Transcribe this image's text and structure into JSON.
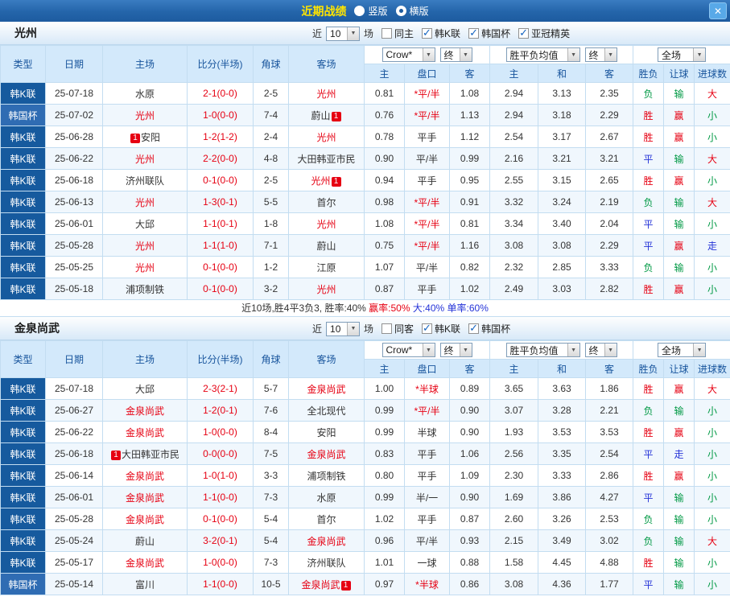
{
  "icons": {
    "dropdown": "▼",
    "close": "✕",
    "check": "✓"
  },
  "colors": {
    "win": "#e60012",
    "draw": "#2433d8",
    "lose": "#009944",
    "team_highlight": "#e60012",
    "score": "#e60012",
    "handicap_star": "#e60012",
    "header_text": "#17549c"
  },
  "league_colors": {
    "韩K联": "#165a9e",
    "韩国杯": "#2f6cb3"
  },
  "titlebar": {
    "title": "近期战绩",
    "vertical_label": "竖版",
    "horizontal_label": "横版",
    "selected_layout": "横版"
  },
  "filter_labels": {
    "near": "近",
    "count": "10",
    "matches": "场",
    "odds_source": "Crow*",
    "final1": "终",
    "avg": "胜平负均值",
    "final2": "终",
    "scope": "全场"
  },
  "table_columns": {
    "type": "类型",
    "date": "日期",
    "home": "主场",
    "score": "比分(半场)",
    "corner": "角球",
    "away": "客场",
    "odds_home": "主",
    "handicap": "盘口",
    "odds_away": "客",
    "avg_home": "主",
    "avg_draw": "和",
    "avg_away": "客",
    "result": "胜负",
    "handicap_result": "让球",
    "goal_line": "进球数"
  },
  "sections": [
    {
      "team": "光州",
      "same_filter": {
        "label": "同主",
        "checked": false
      },
      "league_filters": [
        {
          "label": "韩K联",
          "checked": true
        },
        {
          "label": "韩国杯",
          "checked": true
        },
        {
          "label": "亚冠精英",
          "checked": true
        }
      ],
      "rows": [
        {
          "league": "韩K联",
          "date": "25-07-18",
          "home": {
            "name": "水原"
          },
          "score": "2-1(0-0)",
          "corner": "2-5",
          "away": {
            "name": "光州",
            "highlight": true
          },
          "odds": [
            "0.81",
            "*平/半",
            "1.08"
          ],
          "avg": [
            "2.94",
            "3.13",
            "2.35"
          ],
          "result": "负",
          "handicap_result": "输",
          "goal_result": "大"
        },
        {
          "league": "韩国杯",
          "date": "25-07-02",
          "home": {
            "name": "光州",
            "highlight": true
          },
          "score": "1-0(0-0)",
          "corner": "7-4",
          "away": {
            "name": "蔚山",
            "badge": "1",
            "badge_pos": "after"
          },
          "odds": [
            "0.76",
            "*平/半",
            "1.13"
          ],
          "avg": [
            "2.94",
            "3.18",
            "2.29"
          ],
          "result": "胜",
          "handicap_result": "赢",
          "goal_result": "小"
        },
        {
          "league": "韩K联",
          "date": "25-06-28",
          "home": {
            "name": "安阳",
            "badge": "1",
            "badge_pos": "before"
          },
          "score": "1-2(1-2)",
          "corner": "2-4",
          "away": {
            "name": "光州",
            "highlight": true
          },
          "odds": [
            "0.78",
            "平手",
            "1.12"
          ],
          "avg": [
            "2.54",
            "3.17",
            "2.67"
          ],
          "result": "胜",
          "handicap_result": "赢",
          "goal_result": "小"
        },
        {
          "league": "韩K联",
          "date": "25-06-22",
          "home": {
            "name": "光州",
            "highlight": true
          },
          "score": "2-2(0-0)",
          "corner": "4-8",
          "away": {
            "name": "大田韩亚市民"
          },
          "odds": [
            "0.90",
            "平/半",
            "0.99"
          ],
          "avg": [
            "2.16",
            "3.21",
            "3.21"
          ],
          "result": "平",
          "handicap_result": "输",
          "goal_result": "大"
        },
        {
          "league": "韩K联",
          "date": "25-06-18",
          "home": {
            "name": "济州联队"
          },
          "score": "0-1(0-0)",
          "corner": "2-5",
          "away": {
            "name": "光州",
            "highlight": true,
            "badge": "1",
            "badge_pos": "after"
          },
          "odds": [
            "0.94",
            "平手",
            "0.95"
          ],
          "avg": [
            "2.55",
            "3.15",
            "2.65"
          ],
          "result": "胜",
          "handicap_result": "赢",
          "goal_result": "小"
        },
        {
          "league": "韩K联",
          "date": "25-06-13",
          "home": {
            "name": "光州",
            "highlight": true
          },
          "score": "1-3(0-1)",
          "corner": "5-5",
          "away": {
            "name": "首尔"
          },
          "odds": [
            "0.98",
            "*平/半",
            "0.91"
          ],
          "avg": [
            "3.32",
            "3.24",
            "2.19"
          ],
          "result": "负",
          "handicap_result": "输",
          "goal_result": "大"
        },
        {
          "league": "韩K联",
          "date": "25-06-01",
          "home": {
            "name": "大邱"
          },
          "score": "1-1(0-1)",
          "corner": "1-8",
          "away": {
            "name": "光州",
            "highlight": true
          },
          "odds": [
            "1.08",
            "*平/半",
            "0.81"
          ],
          "avg": [
            "3.34",
            "3.40",
            "2.04"
          ],
          "result": "平",
          "handicap_result": "输",
          "goal_result": "小"
        },
        {
          "league": "韩K联",
          "date": "25-05-28",
          "home": {
            "name": "光州",
            "highlight": true
          },
          "score": "1-1(1-0)",
          "corner": "7-1",
          "away": {
            "name": "蔚山"
          },
          "odds": [
            "0.75",
            "*平/半",
            "1.16"
          ],
          "avg": [
            "3.08",
            "3.08",
            "2.29"
          ],
          "result": "平",
          "handicap_result": "赢",
          "goal_result": "走"
        },
        {
          "league": "韩K联",
          "date": "25-05-25",
          "home": {
            "name": "光州",
            "highlight": true
          },
          "score": "0-1(0-0)",
          "corner": "1-2",
          "away": {
            "name": "江原"
          },
          "odds": [
            "1.07",
            "平/半",
            "0.82"
          ],
          "avg": [
            "2.32",
            "2.85",
            "3.33"
          ],
          "result": "负",
          "handicap_result": "输",
          "goal_result": "小"
        },
        {
          "league": "韩K联",
          "date": "25-05-18",
          "home": {
            "name": "浦项制铁"
          },
          "score": "0-1(0-0)",
          "corner": "3-2",
          "away": {
            "name": "光州",
            "highlight": true
          },
          "odds": [
            "0.87",
            "平手",
            "1.02"
          ],
          "avg": [
            "2.49",
            "3.03",
            "2.82"
          ],
          "result": "胜",
          "handicap_result": "赢",
          "goal_result": "小"
        }
      ],
      "summary": [
        {
          "text": "近10场,胜4平3负3, 胜率:40% ",
          "color": "#333333"
        },
        {
          "text": "赢率:50% ",
          "color": "#e60012"
        },
        {
          "text": "大:40% ",
          "color": "#2433d8"
        },
        {
          "text": "单率:60%",
          "color": "#2433d8"
        }
      ]
    },
    {
      "team": "金泉尚武",
      "same_filter": {
        "label": "同客",
        "checked": false
      },
      "league_filters": [
        {
          "label": "韩K联",
          "checked": true
        },
        {
          "label": "韩国杯",
          "checked": true
        }
      ],
      "rows": [
        {
          "league": "韩K联",
          "date": "25-07-18",
          "home": {
            "name": "大邱"
          },
          "score": "2-3(2-1)",
          "corner": "5-7",
          "away": {
            "name": "金泉尚武",
            "highlight": true
          },
          "odds": [
            "1.00",
            "*半球",
            "0.89"
          ],
          "avg": [
            "3.65",
            "3.63",
            "1.86"
          ],
          "result": "胜",
          "handicap_result": "赢",
          "goal_result": "大"
        },
        {
          "league": "韩K联",
          "date": "25-06-27",
          "home": {
            "name": "金泉尚武",
            "highlight": true
          },
          "score": "1-2(0-1)",
          "corner": "7-6",
          "away": {
            "name": "全北现代"
          },
          "odds": [
            "0.99",
            "*平/半",
            "0.90"
          ],
          "avg": [
            "3.07",
            "3.28",
            "2.21"
          ],
          "result": "负",
          "handicap_result": "输",
          "goal_result": "小"
        },
        {
          "league": "韩K联",
          "date": "25-06-22",
          "home": {
            "name": "金泉尚武",
            "highlight": true
          },
          "score": "1-0(0-0)",
          "corner": "8-4",
          "away": {
            "name": "安阳"
          },
          "odds": [
            "0.99",
            "半球",
            "0.90"
          ],
          "avg": [
            "1.93",
            "3.53",
            "3.53"
          ],
          "result": "胜",
          "handicap_result": "赢",
          "goal_result": "小"
        },
        {
          "league": "韩K联",
          "date": "25-06-18",
          "home": {
            "name": "大田韩亚市民",
            "badge": "1",
            "badge_pos": "before"
          },
          "score": "0-0(0-0)",
          "corner": "7-5",
          "away": {
            "name": "金泉尚武",
            "highlight": true
          },
          "odds": [
            "0.83",
            "平手",
            "1.06"
          ],
          "avg": [
            "2.56",
            "3.35",
            "2.54"
          ],
          "result": "平",
          "handicap_result": "走",
          "goal_result": "小"
        },
        {
          "league": "韩K联",
          "date": "25-06-14",
          "home": {
            "name": "金泉尚武",
            "highlight": true
          },
          "score": "1-0(1-0)",
          "corner": "3-3",
          "away": {
            "name": "浦项制铁"
          },
          "odds": [
            "0.80",
            "平手",
            "1.09"
          ],
          "avg": [
            "2.30",
            "3.33",
            "2.86"
          ],
          "result": "胜",
          "handicap_result": "赢",
          "goal_result": "小"
        },
        {
          "league": "韩K联",
          "date": "25-06-01",
          "home": {
            "name": "金泉尚武",
            "highlight": true
          },
          "score": "1-1(0-0)",
          "corner": "7-3",
          "away": {
            "name": "水原"
          },
          "odds": [
            "0.99",
            "半/一",
            "0.90"
          ],
          "avg": [
            "1.69",
            "3.86",
            "4.27"
          ],
          "result": "平",
          "handicap_result": "输",
          "goal_result": "小"
        },
        {
          "league": "韩K联",
          "date": "25-05-28",
          "home": {
            "name": "金泉尚武",
            "highlight": true
          },
          "score": "0-1(0-0)",
          "corner": "5-4",
          "away": {
            "name": "首尔"
          },
          "odds": [
            "1.02",
            "平手",
            "0.87"
          ],
          "avg": [
            "2.60",
            "3.26",
            "2.53"
          ],
          "result": "负",
          "handicap_result": "输",
          "goal_result": "小"
        },
        {
          "league": "韩K联",
          "date": "25-05-24",
          "home": {
            "name": "蔚山"
          },
          "score": "3-2(0-1)",
          "corner": "5-4",
          "away": {
            "name": "金泉尚武",
            "highlight": true
          },
          "odds": [
            "0.96",
            "平/半",
            "0.93"
          ],
          "avg": [
            "2.15",
            "3.49",
            "3.02"
          ],
          "result": "负",
          "handicap_result": "输",
          "goal_result": "大"
        },
        {
          "league": "韩K联",
          "date": "25-05-17",
          "home": {
            "name": "金泉尚武",
            "highlight": true
          },
          "score": "1-0(0-0)",
          "corner": "7-3",
          "away": {
            "name": "济州联队"
          },
          "odds": [
            "1.01",
            "一球",
            "0.88"
          ],
          "avg": [
            "1.58",
            "4.45",
            "4.88"
          ],
          "result": "胜",
          "handicap_result": "输",
          "goal_result": "小"
        },
        {
          "league": "韩国杯",
          "date": "25-05-14",
          "home": {
            "name": "富川"
          },
          "score": "1-1(0-0)",
          "corner": "10-5",
          "away": {
            "name": "金泉尚武",
            "highlight": true,
            "badge": "1",
            "badge_pos": "after"
          },
          "odds": [
            "0.97",
            "*半球",
            "0.86"
          ],
          "avg": [
            "3.08",
            "4.36",
            "1.77"
          ],
          "result": "平",
          "handicap_result": "输",
          "goal_result": "小"
        }
      ],
      "summary": []
    }
  ]
}
